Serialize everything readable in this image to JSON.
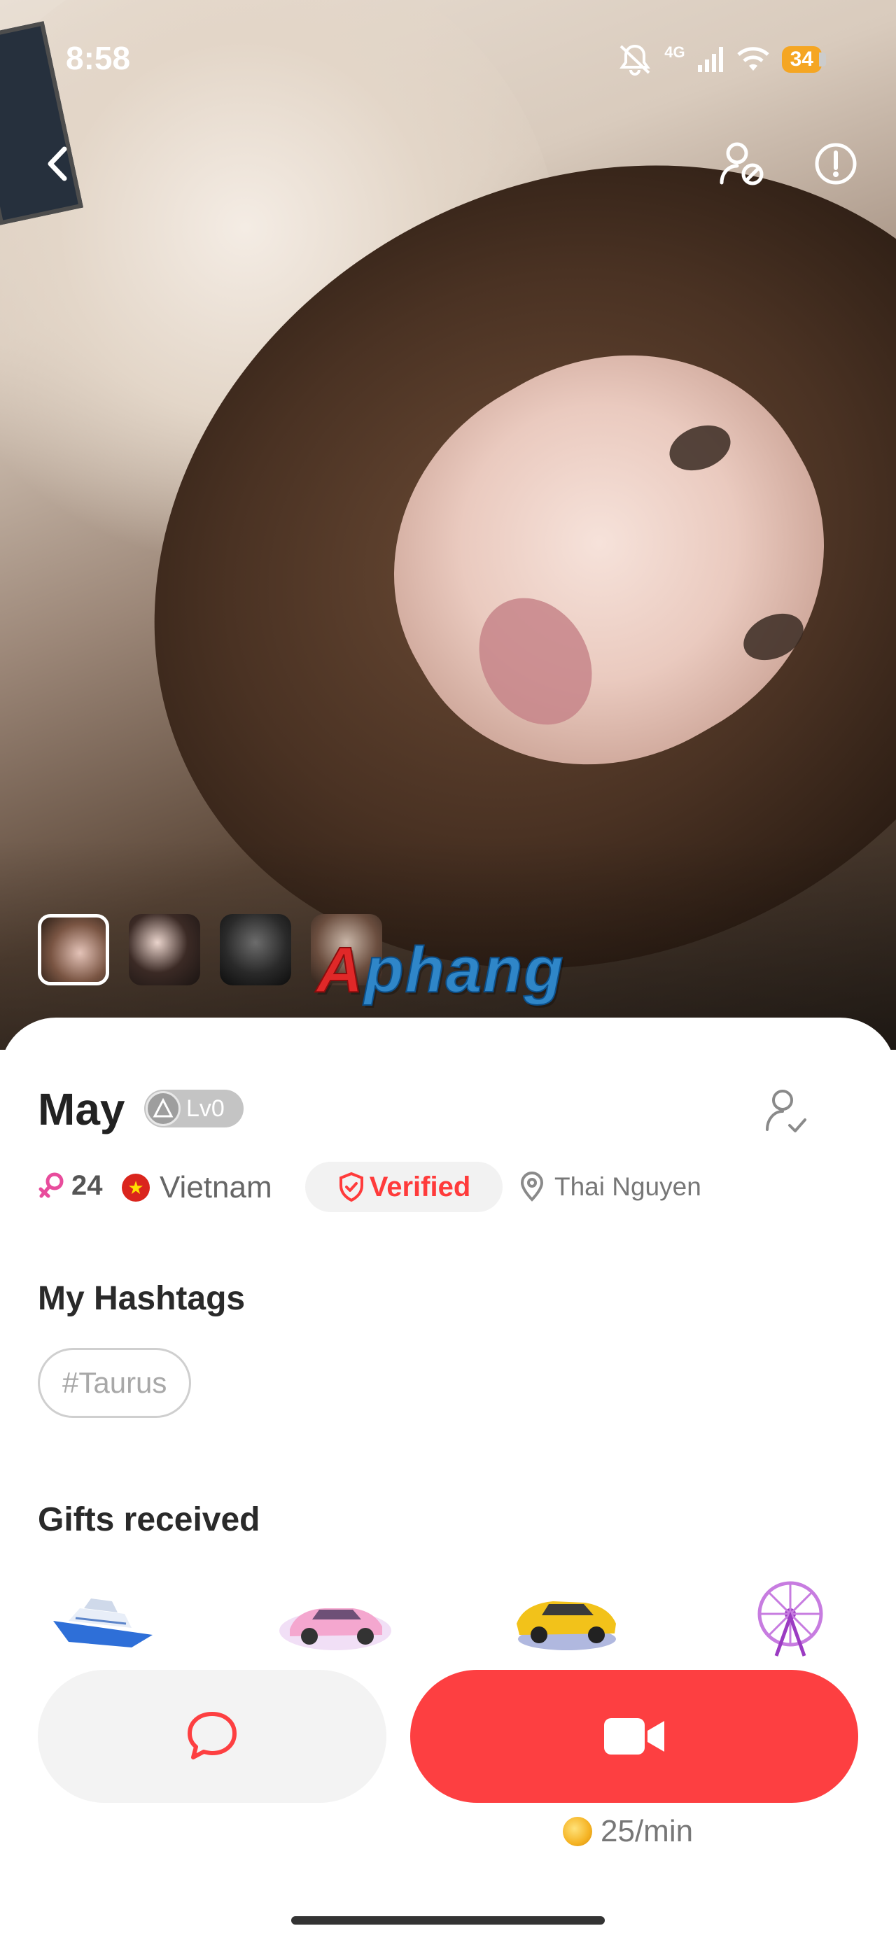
{
  "status_bar": {
    "time": "8:58",
    "network": "4G",
    "battery": "34"
  },
  "top_bar": {
    "back_icon": "chevron-left-icon",
    "block_icon": "user-block-icon",
    "report_icon": "alert-circle-icon"
  },
  "photos": {
    "count": 4,
    "selected_index": 0,
    "watermark": "Aphang"
  },
  "profile": {
    "name": "May",
    "level": "Lv0",
    "age": "24",
    "country": "Vietnam",
    "verified_label": "Verified",
    "city": "Thai Nguyen"
  },
  "hashtags": {
    "title": "My Hashtags",
    "items": [
      "#Taurus"
    ]
  },
  "gifts": {
    "title": "Gifts received",
    "items": [
      "yacht",
      "pink-sports-car",
      "yellow-sports-car",
      "ferris-wheel"
    ]
  },
  "actions": {
    "rate": "25/min"
  },
  "colors": {
    "accent": "#fd3f41",
    "verified": "#ff3b3b",
    "battery": "#f5a623",
    "gender": "#e84c9c"
  }
}
